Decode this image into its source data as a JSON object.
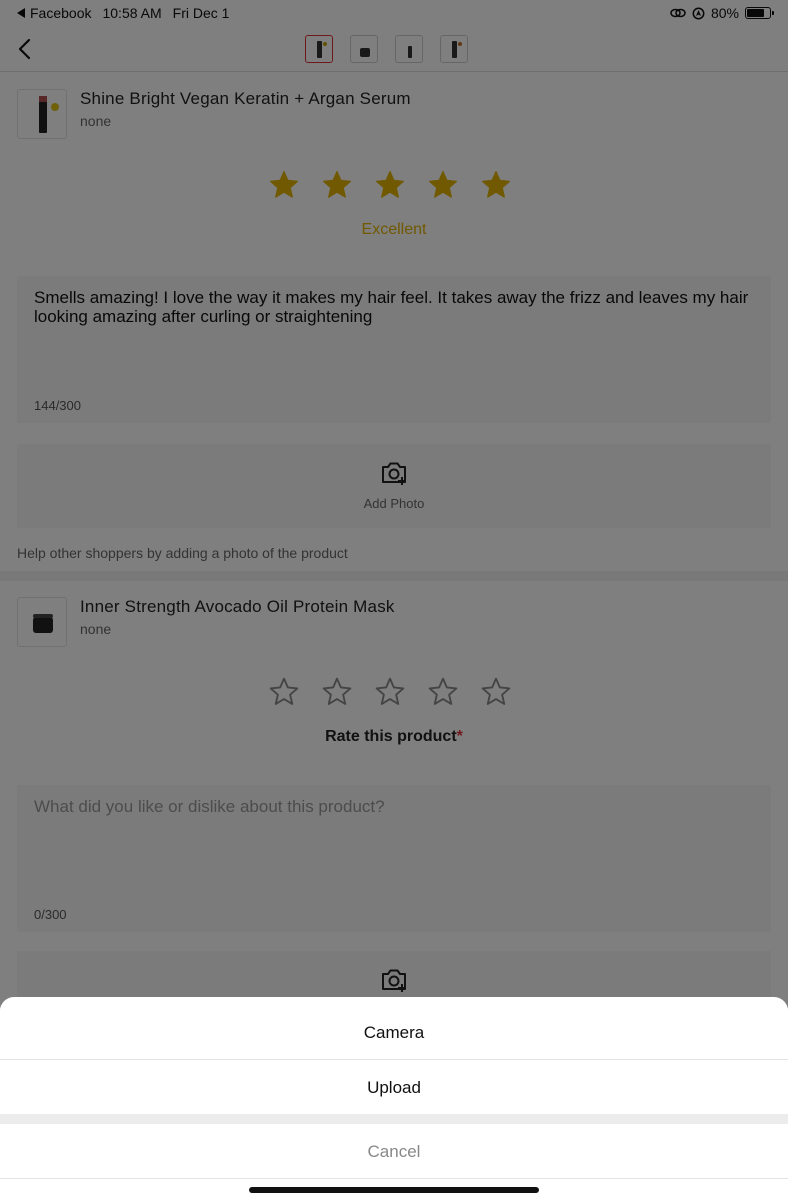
{
  "status_bar": {
    "back_app": "Facebook",
    "time": "10:58 AM",
    "date": "Fri Dec 1",
    "battery_percent": "80%",
    "battery_level": 0.8,
    "icons": [
      "back-triangle-icon",
      "link-icon",
      "location-lock-icon",
      "battery-icon"
    ]
  },
  "nav": {
    "back_icon": "chevron-left-icon",
    "thumbnails": [
      "product-1",
      "product-2",
      "product-3",
      "product-4"
    ],
    "active_thumbnail": 0
  },
  "products": [
    {
      "name": "Shine Bright Vegan Keratin + Argan Serum",
      "variant": "none",
      "rating": 5,
      "rating_label": "Excellent",
      "review_text": "Smells amazing! I love the way it makes my hair feel. It takes away the frizz and leaves my hair looking amazing after curling or straightening",
      "char_count": "144/300",
      "add_photo_label": "Add Photo",
      "help_text": "Help other shoppers by adding a photo of the product"
    },
    {
      "name": "Inner Strength Avocado Oil Protein Mask",
      "variant": "none",
      "rating": 0,
      "rating_label": "Rate this product",
      "required_mark": "*",
      "review_placeholder": "What did you like or dislike about this product?",
      "char_count": "0/300"
    }
  ],
  "action_sheet": {
    "camera_label": "Camera",
    "upload_label": "Upload",
    "cancel_label": "Cancel"
  },
  "colors": {
    "star_filled": "#e1b300",
    "star_empty_stroke": "#888888",
    "required": "#e0303a",
    "active_thumb_border": "#dd3333"
  }
}
